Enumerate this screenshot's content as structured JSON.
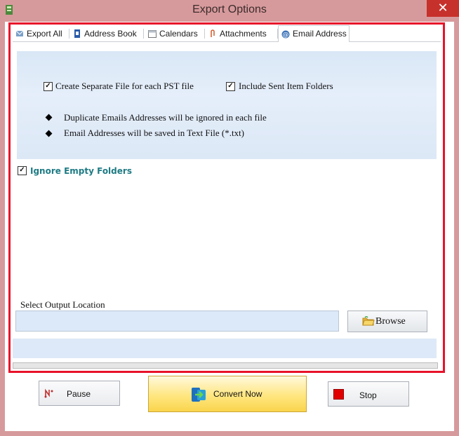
{
  "window": {
    "title": "Export Options",
    "close_label": "✕"
  },
  "tabs": [
    {
      "label": "Export All",
      "icon": "export-all-icon"
    },
    {
      "label": "Address Book",
      "icon": "address-book-icon"
    },
    {
      "label": "Calendars",
      "icon": "calendar-icon"
    },
    {
      "label": "Attachments",
      "icon": "attachment-icon"
    },
    {
      "label": "Email Address",
      "icon": "at-sign-icon",
      "active": true
    }
  ],
  "options": {
    "separate_file": {
      "label": "Create Separate File for each PST file",
      "checked": true
    },
    "sent_items": {
      "label": "Include Sent Item Folders",
      "checked": true
    },
    "notes": [
      "Duplicate Emails Addresses will be ignored in each file",
      "Email Addresses will be saved in Text File (*.txt)"
    ],
    "ignore_empty": {
      "label": "Ignore Empty Folders",
      "checked": true
    }
  },
  "output": {
    "label": "Select Output Location",
    "value": "",
    "browse_label": "Browse"
  },
  "buttons": {
    "pause": "Pause",
    "convert": "Convert Now",
    "stop": "Stop"
  },
  "check_mark": "✓",
  "colors": {
    "accent_red": "#e8132a",
    "panel_blue": "#dce9f9",
    "teal_label": "#1e7b84",
    "convert_yellow": "#ffe680"
  }
}
